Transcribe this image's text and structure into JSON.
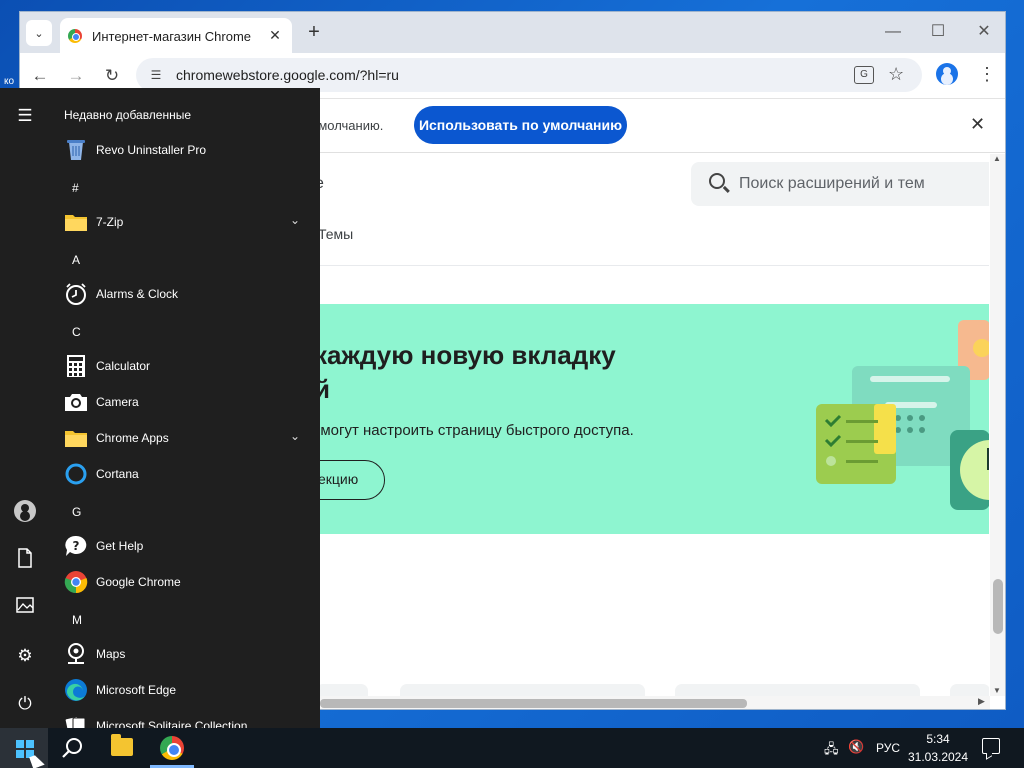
{
  "desktop": {
    "label": "ко"
  },
  "browser": {
    "tab_title": "Интернет-магазин Chrome",
    "url": "chromewebstore.google.com/?hl=ru",
    "infobar_text": "умолчанию.",
    "infobar_button": "Использовать по умолчанию",
    "accent": "#0b57d0"
  },
  "store": {
    "title_fragment": "e",
    "search_placeholder": "Поиск расширений и тем",
    "tab_themes": "Темы",
    "banner": {
      "title_line1": "каждую новую вкладку",
      "title_line2": "й",
      "description": "омогут настроить страницу быстрого доступа.",
      "button": "екцию",
      "color": "#8ef5d0"
    }
  },
  "start_menu": {
    "recent_header": "Недавно добавленные",
    "letters": [
      "#",
      "A",
      "C",
      "G",
      "M"
    ],
    "apps": [
      {
        "label": "Revo Uninstaller Pro",
        "icon": "revo-uninstaller-icon"
      },
      {
        "label": "7-Zip",
        "icon": "folder-icon"
      },
      {
        "label": "Alarms & Clock",
        "icon": "clock-icon"
      },
      {
        "label": "Calculator",
        "icon": "calculator-icon"
      },
      {
        "label": "Camera",
        "icon": "camera-icon"
      },
      {
        "label": "Chrome Apps",
        "icon": "folder-icon"
      },
      {
        "label": "Cortana",
        "icon": "cortana-icon"
      },
      {
        "label": "Get Help",
        "icon": "help-icon"
      },
      {
        "label": "Google Chrome",
        "icon": "chrome-icon"
      },
      {
        "label": "Maps",
        "icon": "maps-icon"
      },
      {
        "label": "Microsoft Edge",
        "icon": "edge-icon"
      },
      {
        "label": "Microsoft Solitaire Collection",
        "icon": "solitaire-icon"
      }
    ]
  },
  "taskbar": {
    "language": "РУС",
    "time": "5:34",
    "date": "31.03.2024"
  }
}
